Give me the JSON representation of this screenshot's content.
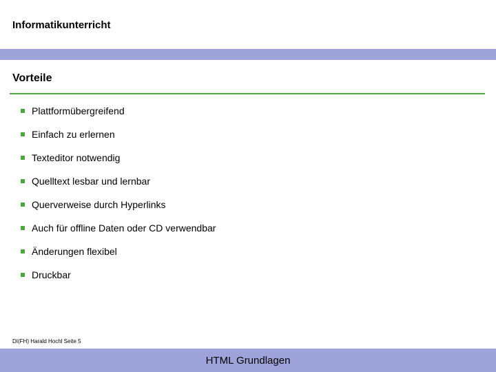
{
  "header": {
    "title": "Informatikunterricht"
  },
  "section": {
    "title": "Vorteile"
  },
  "items": [
    "Plattformübergreifend",
    "Einfach zu erlernen",
    "Texteditor notwendig",
    "Quelltext lesbar und lernbar",
    "Querverweise durch Hyperlinks",
    "Auch für offline Daten oder CD verwendbar",
    "Änderungen flexibel",
    "Druckbar"
  ],
  "footer": {
    "credit": "DI(FH) Harald Hochl  Seite 5",
    "bar_text": "HTML Grundlagen"
  }
}
